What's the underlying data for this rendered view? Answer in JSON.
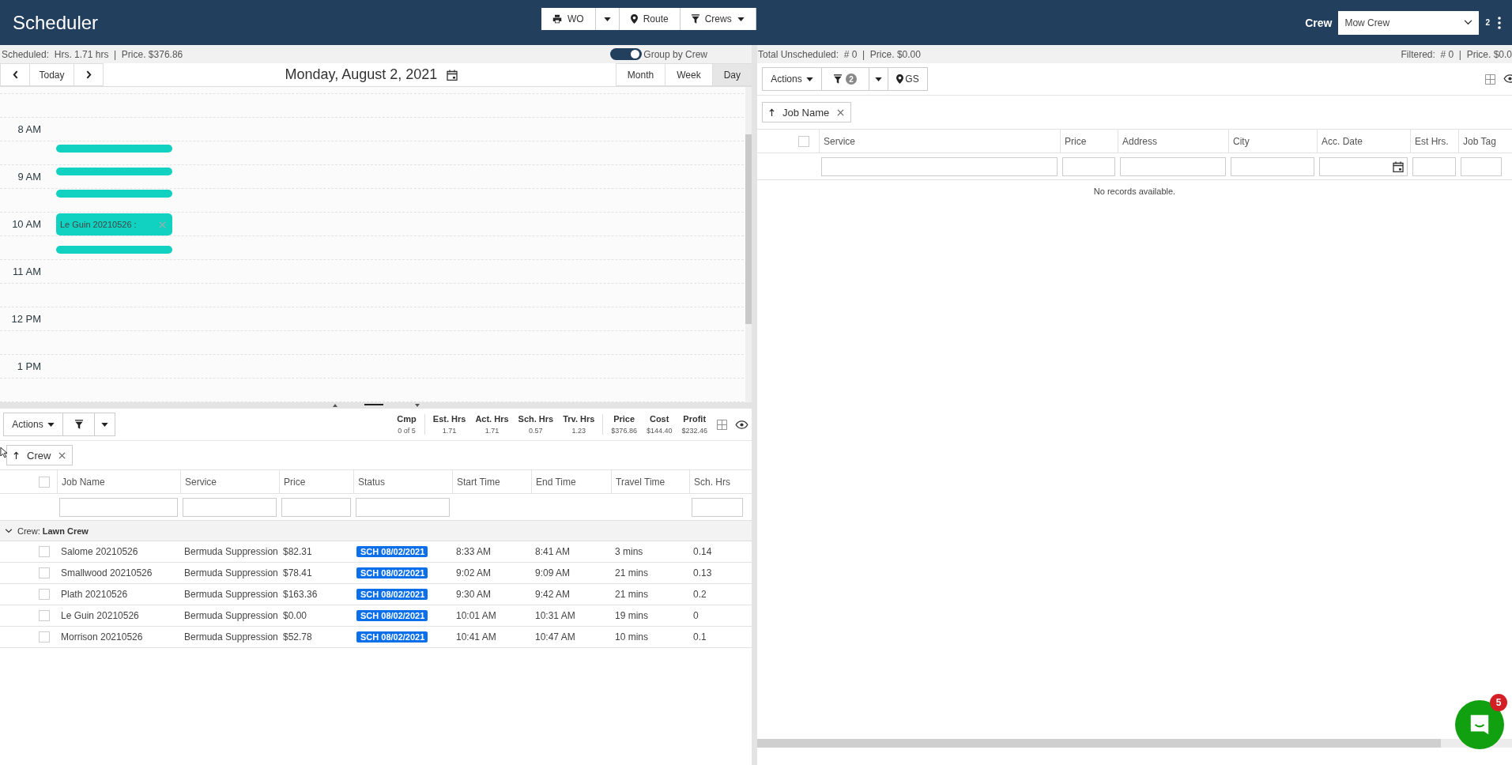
{
  "header": {
    "title": "Scheduler",
    "toolbar": [
      {
        "kind": "button",
        "label": "WO"
      },
      {
        "kind": "caret"
      },
      {
        "kind": "button",
        "label": "Route"
      },
      {
        "kind": "dropdown",
        "label": "Crews"
      }
    ],
    "crew_label": "Crew",
    "crew_select": "Mow Crew",
    "crew_count": "2"
  },
  "schedule": {
    "summary": "Scheduled:  Hrs. 1.71 hrs  |  Price. $376.86",
    "group_by_crew": {
      "label": "Group by Crew",
      "on": true
    },
    "nav": {
      "today": "Today"
    },
    "date": "Monday, August 2, 2021",
    "views": [
      {
        "label": "Month",
        "selected": false
      },
      {
        "label": "Week",
        "selected": false
      },
      {
        "label": "Day",
        "selected": true
      }
    ],
    "hours": [
      "8 AM",
      "9 AM",
      "10 AM",
      "11 AM",
      "12 PM",
      "1 PM"
    ],
    "events": [
      {
        "kind": "bar"
      },
      {
        "kind": "bar"
      },
      {
        "kind": "bar"
      },
      {
        "kind": "block",
        "label": "Le Guin 20210526 :"
      },
      {
        "kind": "bar"
      }
    ]
  },
  "jobs": {
    "actions": "Actions",
    "stat_groups": [
      [
        {
          "label": "Cmp",
          "value": "0 of 5"
        }
      ],
      [
        {
          "label": "Est. Hrs",
          "value": "1.71"
        },
        {
          "label": "Act. Hrs",
          "value": "1.71"
        },
        {
          "label": "Sch. Hrs",
          "value": "0.57"
        },
        {
          "label": "Trv. Hrs",
          "value": "1.23"
        }
      ],
      [
        {
          "label": "Price",
          "value": "$376.86"
        },
        {
          "label": "Cost",
          "value": "$144.40"
        },
        {
          "label": "Profit",
          "value": "$232.46"
        }
      ]
    ],
    "sort_chip": "Crew",
    "select_all_checked": false,
    "columns": [
      {
        "label": "Job Name",
        "filter": true
      },
      {
        "label": "Service",
        "filter": true
      },
      {
        "label": "Price",
        "filter": true
      },
      {
        "label": "Status",
        "filter": true
      },
      {
        "label": "Start Time",
        "filter": false
      },
      {
        "label": "End Time",
        "filter": false
      },
      {
        "label": "Travel Time",
        "filter": false
      },
      {
        "label": "Sch. Hrs",
        "filter": true
      }
    ],
    "group": {
      "label": "Crew:  **Lawn Crew**",
      "expanded": true
    },
    "rows": [
      {
        "checked": false,
        "cells": [
          "Salome 20210526",
          "Bermuda Suppression",
          "$82.31",
          "SCH 08/02/2021",
          "8:33 AM",
          "8:41 AM",
          "3 mins",
          "0.14"
        ]
      },
      {
        "checked": false,
        "cells": [
          "Smallwood 20210526",
          "Bermuda Suppression",
          "$78.41",
          "SCH 08/02/2021",
          "9:02 AM",
          "9:09 AM",
          "21 mins",
          "0.13"
        ]
      },
      {
        "checked": false,
        "cells": [
          "Plath 20210526",
          "Bermuda Suppression",
          "$163.36",
          "SCH 08/02/2021",
          "9:30 AM",
          "9:42 AM",
          "21 mins",
          "0.2"
        ]
      },
      {
        "checked": false,
        "cells": [
          "Le Guin 20210526",
          "Bermuda Suppression",
          "$0.00",
          "SCH 08/02/2021",
          "10:01 AM",
          "10:31 AM",
          "19 mins",
          "0"
        ]
      },
      {
        "checked": false,
        "cells": [
          "Morrison 20210526",
          "Bermuda Suppression",
          "$52.78",
          "SCH 08/02/2021",
          "10:41 AM",
          "10:47 AM",
          "10 mins",
          "0.1"
        ]
      }
    ]
  },
  "unscheduled": {
    "summary": "Total Unscheduled:  # 0  |  Price. $0.00",
    "filtered": "Filtered:  # 0  |  Price. $0.0",
    "actions": "Actions",
    "filter_count": "2",
    "gs": "GS",
    "sort_chip": "Job Name",
    "select_all_checked": false,
    "columns": [
      {
        "label": "Service",
        "kind": "text"
      },
      {
        "label": "Price",
        "kind": "text"
      },
      {
        "label": "Address",
        "kind": "text"
      },
      {
        "label": "City",
        "kind": "text"
      },
      {
        "label": "Acc. Date",
        "kind": "date"
      },
      {
        "label": "Est Hrs.",
        "kind": "text"
      },
      {
        "label": "Job Tag",
        "kind": "text"
      }
    ],
    "empty": "No records available."
  },
  "chat": {
    "badge": "5"
  }
}
